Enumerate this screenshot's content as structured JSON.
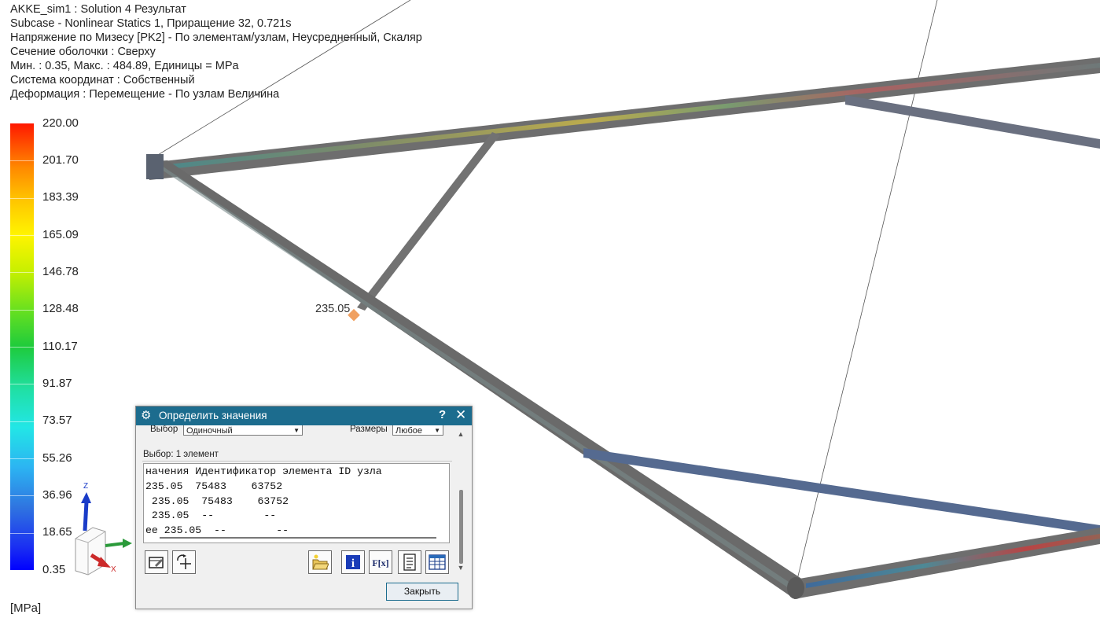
{
  "header": {
    "lines": [
      "AKKE_sim1 : Solution 4 Результат",
      "Subcase - Nonlinear Statics 1, Приращение 32, 0.721s",
      "Напряжение по Мизесу [PK2] - По элементам/узлам, Неусредненный, Скаляр",
      "Сечение оболочки : Сверху",
      "Мин. : 0.35, Макс. : 484.89, Единицы = MPa",
      "Система координат : Собственный",
      "Деформация : Перемещение - По узлам Величина"
    ]
  },
  "legend": {
    "ticks": [
      "220.00",
      "201.70",
      "183.39",
      "165.09",
      "146.78",
      "128.48",
      "110.17",
      "91.87",
      "73.57",
      "55.26",
      "36.96",
      "18.65",
      "0.35"
    ],
    "unit": "[MPa]"
  },
  "probe": {
    "label": "235.05"
  },
  "triad": {
    "z_label": "Z",
    "x_label": "X"
  },
  "dialog": {
    "title": "Определить значения",
    "help": "?",
    "close_glyph": "✕",
    "selection_label": "Выбор",
    "selection_value": "Одиночный",
    "size_label": "Размеры",
    "size_value": "Любое",
    "selected_info": "Выбор:  1 элемент",
    "list": {
      "header": "начения Идентификатор элемента ID узла",
      "rows": [
        "235.05  75483    63752",
        " 235.05  75483    63752",
        " 235.05  --        --",
        "ee 235.05  --        --"
      ]
    },
    "close_button": "Закрыть"
  },
  "colors": {
    "title_bar": "#1c6c8e",
    "beam_gray": "#6e6e6e"
  }
}
